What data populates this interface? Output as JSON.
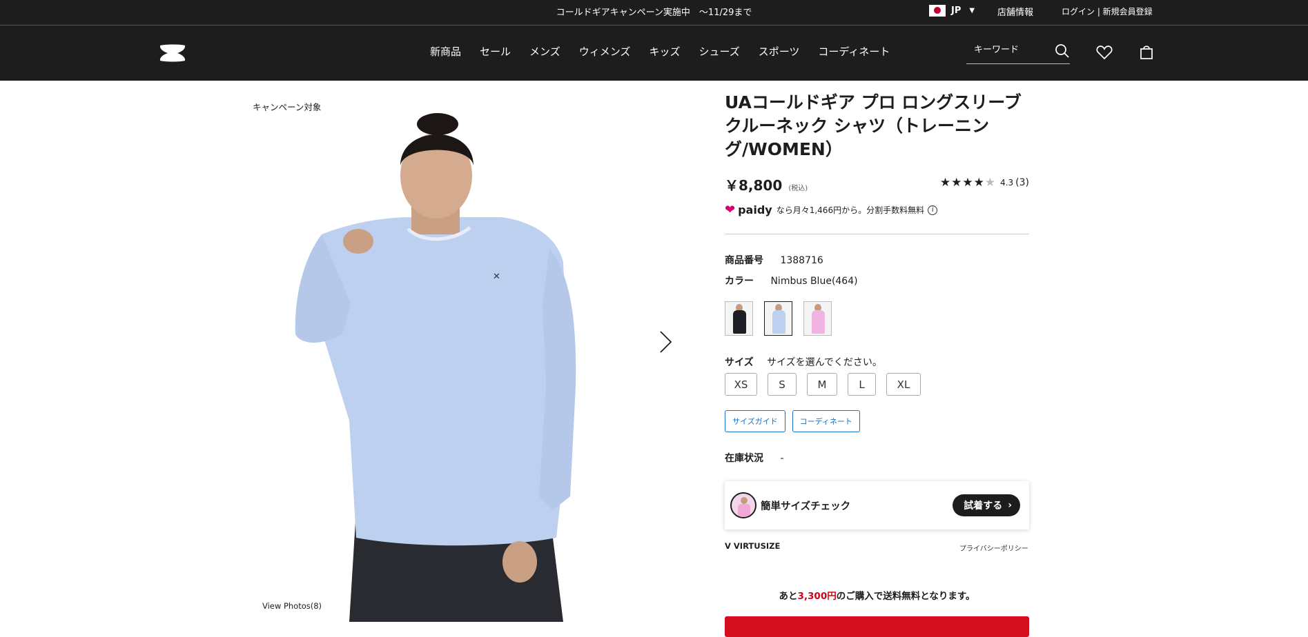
{
  "topbar": {
    "promo": "コールドギアキャンペーン実施中　～11/29まで",
    "country": "JP",
    "store_info": "店舗情報",
    "login": "ログイン | 新規会員登録"
  },
  "header": {
    "nav": [
      "新商品",
      "セール",
      "メンズ",
      "ウィメンズ",
      "キッズ",
      "シューズ",
      "スポーツ",
      "コーディネート"
    ],
    "search_placeholder": "キーワード"
  },
  "gallery": {
    "campaign_badge": "キャンペーン対象",
    "view_photos": "View Photos(8)"
  },
  "product": {
    "title": "UAコールドギア プロ ロングスリーブ クルーネック シャツ（トレーニング/WOMEN）",
    "price": "￥8,800",
    "tax_note": "(税込)",
    "rating_score": "4.3",
    "rating_count": "(3)",
    "rating_value": 4.3,
    "paidy_brand": "paidy",
    "paidy_text": "なら月々1,466円から。分割手数料無料",
    "sku_label": "商品番号",
    "sku": "1388716",
    "color_label": "カラー",
    "color_value": "Nimbus Blue(464)",
    "swatches": [
      {
        "name": "black",
        "color": "#1e1e24"
      },
      {
        "name": "nimbus-blue",
        "color": "#bdd0ef"
      },
      {
        "name": "pink",
        "color": "#efb4e1"
      }
    ],
    "size_label": "サイズ",
    "size_prompt": "サイズを選んでください。",
    "sizes": [
      "XS",
      "S",
      "M",
      "L",
      "XL"
    ],
    "size_guide": "サイズガイド",
    "coordinate": "コーディネート",
    "stock_label": "在庫状況",
    "stock_value": "-"
  },
  "virtusize": {
    "label": "簡単サイズチェック",
    "button": "試着する",
    "brand": "VIRTUSIZE",
    "privacy": "プライバシーポリシー"
  },
  "shipping": {
    "prefix": "あと",
    "amount": "3,300円",
    "suffix": "のご購入で送料無料となります。"
  },
  "colors": {
    "header_bg": "#1d1d1d",
    "accent_red": "#d40e1f",
    "link_blue": "#1a6fc4",
    "paidy_pink": "#d6006e"
  }
}
